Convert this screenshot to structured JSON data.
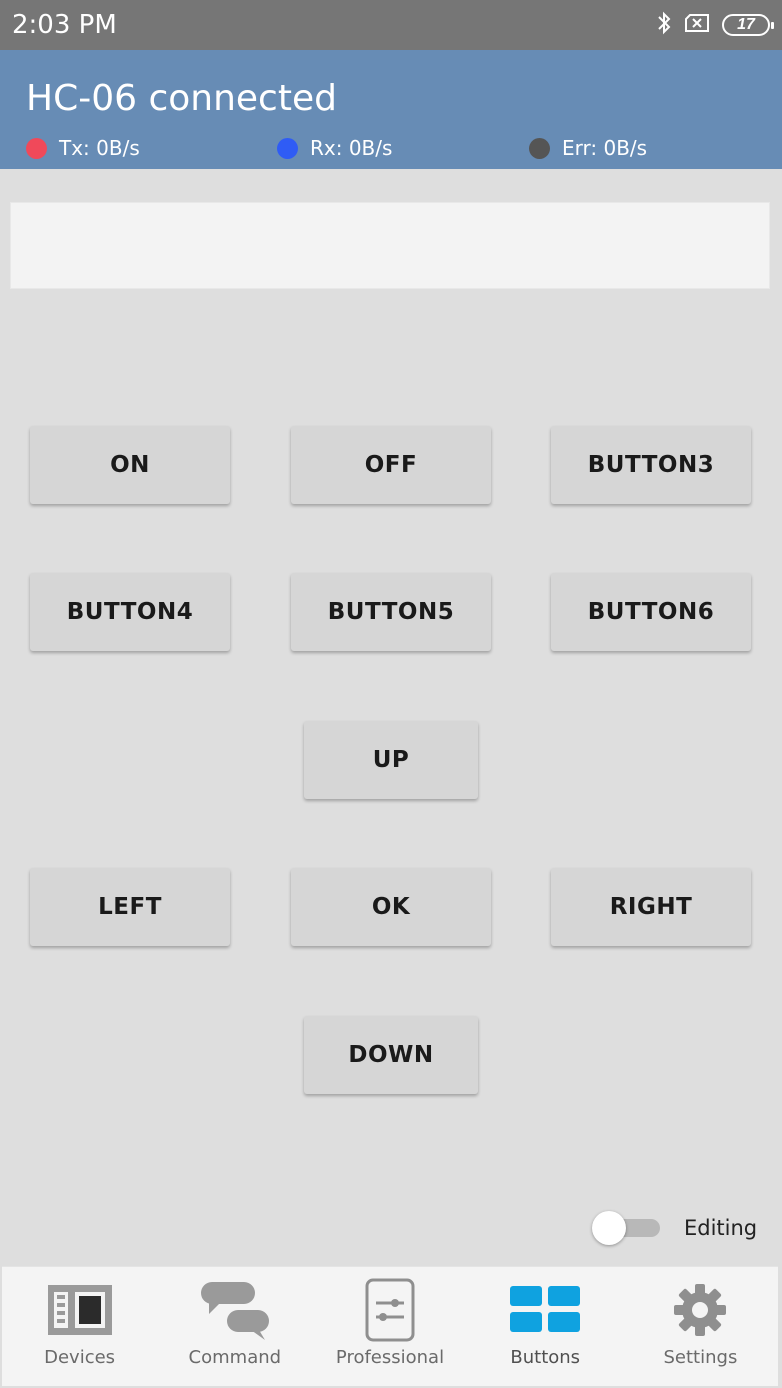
{
  "status_bar": {
    "time": "2:03 PM",
    "battery_level": "17",
    "icons": [
      "bluetooth-icon",
      "sim-disabled-icon",
      "battery-icon"
    ]
  },
  "app_bar": {
    "title": "HC-06 connected",
    "stats": [
      {
        "label": "Tx: 0B/s",
        "color": "#f0495a"
      },
      {
        "label": "Rx: 0B/s",
        "color": "#2f5cf5"
      },
      {
        "label": "Err: 0B/s",
        "color": "#555555"
      }
    ]
  },
  "terminal": {
    "content": ""
  },
  "buttons": {
    "on": "ON",
    "off": "OFF",
    "button3": "BUTTON3",
    "button4": "BUTTON4",
    "button5": "BUTTON5",
    "button6": "BUTTON6",
    "up": "UP",
    "left": "LEFT",
    "ok": "OK",
    "right": "RIGHT",
    "down": "DOWN"
  },
  "editing": {
    "label": "Editing",
    "enabled": false
  },
  "bottom_nav": {
    "items": [
      {
        "label": "Devices",
        "icon": "devices-icon"
      },
      {
        "label": "Command",
        "icon": "chat-bubbles-icon"
      },
      {
        "label": "Professional",
        "icon": "sliders-icon"
      },
      {
        "label": "Buttons",
        "icon": "grid-icon",
        "active": true
      },
      {
        "label": "Settings",
        "icon": "gear-icon"
      }
    ],
    "active_color": "#0fa2e0",
    "inactive_color": "#8f8f8f"
  }
}
